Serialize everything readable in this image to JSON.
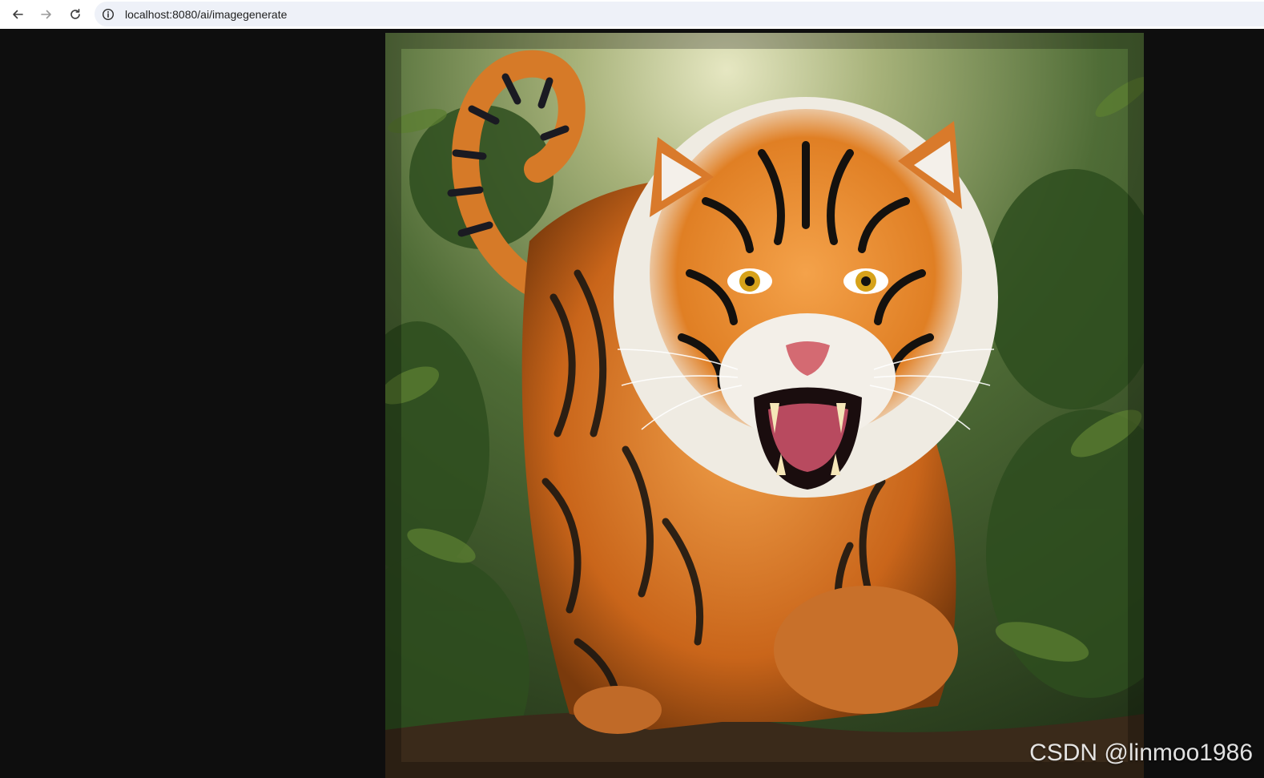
{
  "browser": {
    "url": "localhost:8080/ai/imagegenerate",
    "icons": {
      "back": "arrow-left-icon",
      "forward": "arrow-right-icon",
      "reload": "reload-icon",
      "site_info": "info-icon"
    }
  },
  "image": {
    "subject": "tiger",
    "watermark": "CSDN @linmoo1986"
  },
  "colors": {
    "page_background": "#0e0e0e",
    "address_bar": "#eef1f8",
    "tiger_orange": "#d8741e",
    "foliage": "#3a5a2a"
  }
}
